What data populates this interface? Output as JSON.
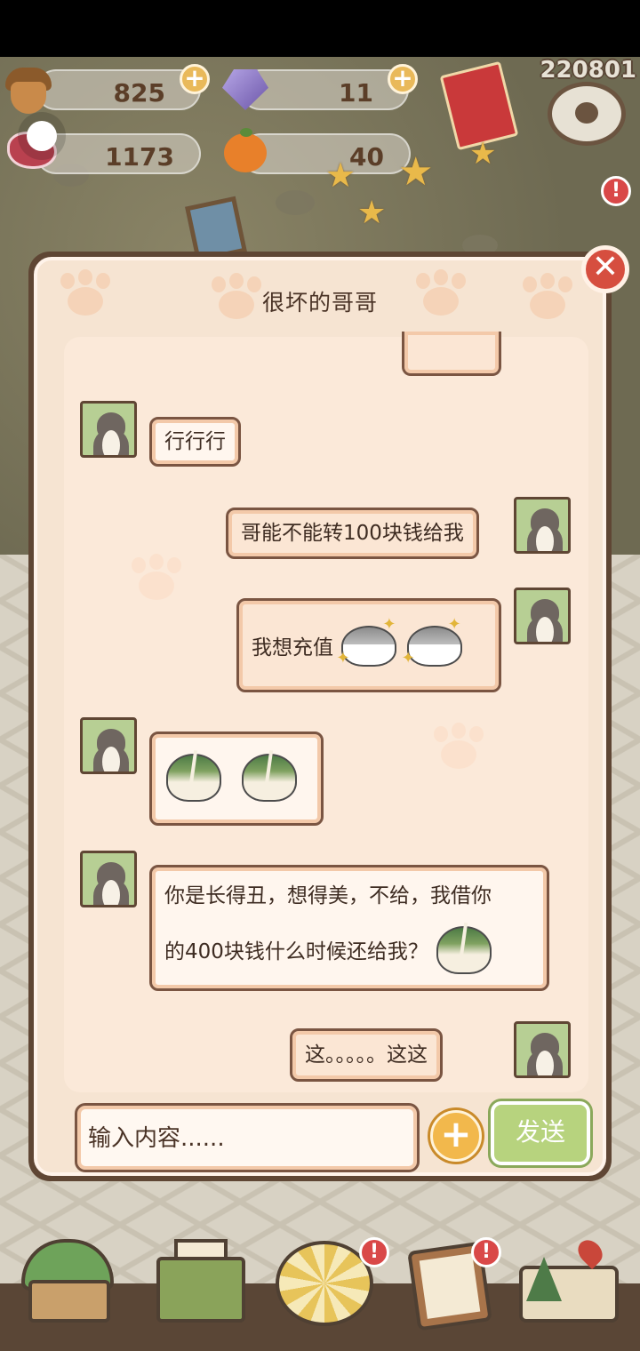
{
  "resources": {
    "acorn": "825",
    "gem": "11",
    "meat": "1173",
    "orange": "40"
  },
  "version_label": "220801",
  "badge_text": "!",
  "dialog": {
    "title": "很坏的哥哥",
    "close_symbol": "✕"
  },
  "messages": [
    {
      "side": "left",
      "text": "行行行"
    },
    {
      "side": "right",
      "text": "哥能不能转100块钱给我"
    },
    {
      "side": "right",
      "text": "我想充值",
      "emoji": [
        "seal-sparkle-sticker",
        "seal-sparkle-sticker"
      ]
    },
    {
      "side": "left",
      "emoji": [
        "broken-heart-bun-sticker",
        "broken-heart-bun-sticker"
      ]
    },
    {
      "side": "left",
      "lines": [
        "你是长得丑，想得美，不给，我借你",
        "的400块钱什么时候还给我？"
      ],
      "emoji": [
        "broken-heart-bun-sticker"
      ]
    },
    {
      "side": "right",
      "text": "这。。。。。这这"
    }
  ],
  "composer": {
    "placeholder": "输入内容......",
    "add_symbol": "+",
    "send_label": "发送"
  },
  "colors": {
    "dialog_border": "#5f4634",
    "dialog_fill": "#f6e4d2",
    "send_button": "#b7d37e",
    "close_button": "#d64e3f",
    "plus_button": "#f2b84c"
  },
  "bottom_nav": [
    "home-house-icon",
    "mail-letter-icon",
    "seal-emblem-icon",
    "task-clipboard-icon",
    "map-icon"
  ]
}
